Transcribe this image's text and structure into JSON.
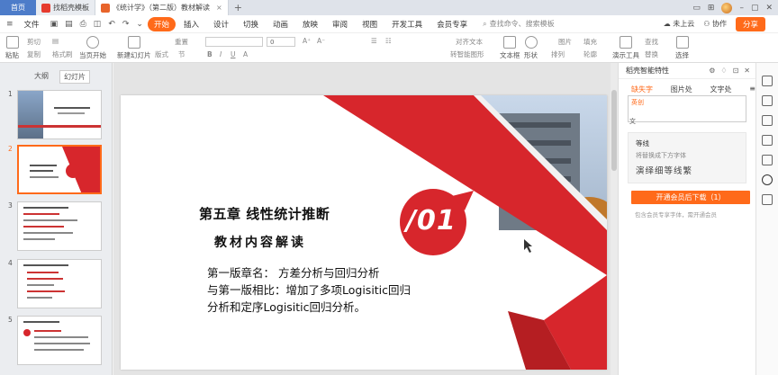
{
  "tabs": {
    "home": "首页",
    "template": "找稻壳模板",
    "document": "《统计学》（第二版）教材解读"
  },
  "tab_add": "+",
  "menu": {
    "file": "文件",
    "items": [
      "开始",
      "插入",
      "设计",
      "切换",
      "动画",
      "放映",
      "审阅",
      "视图",
      "开发工具",
      "会员专享"
    ],
    "search_placeholder": "查找命令、搜索模板",
    "cloud": "未上云",
    "collab": "协作",
    "share": "分享"
  },
  "ribbon": {
    "paste": "粘贴",
    "cut": "剪切",
    "copy": "复制",
    "format_painter": "格式刷",
    "from_current": "当页开始",
    "new_slide": "新建幻灯片",
    "layout": "版式",
    "section": "节",
    "reset": "重置",
    "font_size": "0",
    "align_text": "对齐文本",
    "convert_smartart": "转智能图形",
    "textbox": "文本框",
    "shape": "形状",
    "arrange": "排列",
    "picture": "图片",
    "fill": "填充",
    "outline": "轮廓",
    "presenter_tools": "演示工具",
    "find": "查找",
    "replace": "替换",
    "select": "选择"
  },
  "left_panel": {
    "tab_outline": "大纲",
    "tab_slides": "幻灯片",
    "slide_numbers": [
      "1",
      "2",
      "3",
      "4",
      "5"
    ]
  },
  "slide": {
    "title": "第五章 线性统计推断",
    "subtitle": "教材内容解读",
    "body_lines": [
      "第一版章名： 方差分析与回归分析",
      "与第一版相比：增加了多项Logisitic回归",
      "分析和定序Logisitic回归分析。"
    ],
    "badge": "/01"
  },
  "right_panel": {
    "title": "稻壳智能特性",
    "tabs": [
      "缺失字体",
      "图片处理",
      "文字处理"
    ],
    "box_text": "英创",
    "label": "文",
    "font_name": "等线",
    "font_hint": "将替换成下方字体",
    "font_sample": "演绎细等线繁",
    "download_button": "开通会员后下载（1）",
    "note": "包含会员专享字体，需开通会员"
  },
  "colors": {
    "accent": "#ff6a1a",
    "slide_red": "#d7262c",
    "home_tab": "#4d7cc9"
  }
}
